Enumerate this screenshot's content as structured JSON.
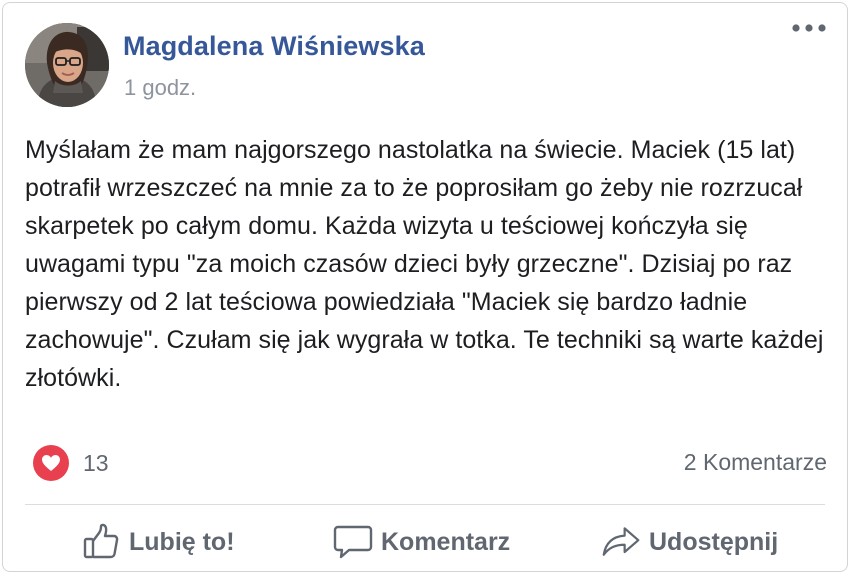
{
  "post": {
    "author": "Magdalena Wiśniewska",
    "time": "1 godz.",
    "text": "Myślałam że mam najgorszego nastolatka na świecie. Maciek (15 lat) potrafił wrzeszczeć na mnie za to że poprosiłam go żeby nie rozrzucał skarpetek po całym domu. Każda wizyta u teściowej kończyła się uwagami typu \"za moich czasów dzieci były grzeczne\". Dzisiaj po raz pierwszy od 2 lat teściowa powiedziała \"Maciek się bardzo ładnie zachowuje\". Czułam się jak wygrała w totka. Te techniki są warte każdej złotówki."
  },
  "reactions": {
    "icon": "heart-icon",
    "count": "13",
    "comments": "2 Komentarze"
  },
  "actions": {
    "like_label": "Lubię to!",
    "comment_label": "Komentarz",
    "share_label": "Udostępnij"
  },
  "colors": {
    "author": "#365899",
    "heart": "#e8404e",
    "muted": "#606770"
  }
}
